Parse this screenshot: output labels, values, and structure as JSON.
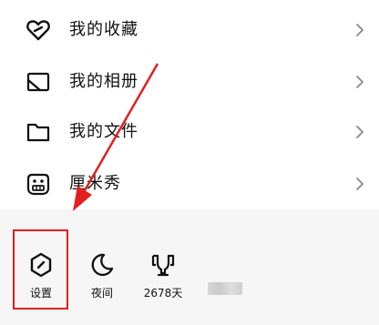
{
  "menu": {
    "items": [
      {
        "label": "我的收藏",
        "icon": "heart-favorite-icon"
      },
      {
        "label": "我的相册",
        "icon": "album-icon"
      },
      {
        "label": "我的文件",
        "icon": "folder-icon"
      },
      {
        "label": "厘米秀",
        "icon": "cmshow-face-icon"
      }
    ]
  },
  "toolbar": {
    "settings": {
      "label": "设置",
      "icon": "settings-hexagon-icon"
    },
    "night": {
      "label": "夜间",
      "icon": "moon-icon"
    },
    "days": {
      "label": "2678天",
      "icon": "trophy-icon"
    }
  },
  "colors": {
    "annotation": "#e02020",
    "bottom_bg": "#f6f6f6"
  }
}
